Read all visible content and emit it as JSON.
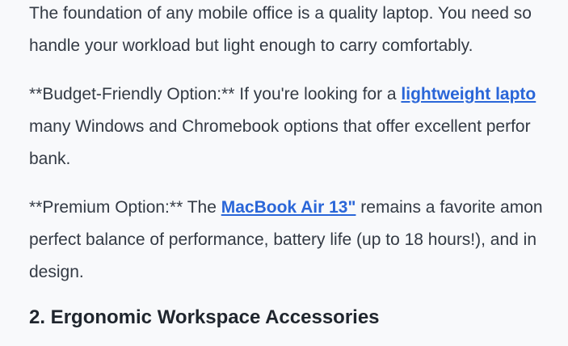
{
  "article": {
    "paragraphs": [
      {
        "line1": "The foundation of any mobile office is a quality laptop. You need so",
        "line2": "handle your workload but light enough to carry comfortably."
      },
      {
        "prefix": "**Budget-Friendly Option:** If you're looking for a ",
        "link": "lightweight lapto",
        "line2": "many Windows and Chromebook options that offer excellent perfor",
        "line3": "bank."
      },
      {
        "prefix": "**Premium Option:** The ",
        "link": "MacBook Air 13\"",
        "suffix": " remains a favorite amon",
        "line2": "perfect balance of performance, battery life (up to 18 hours!), and in",
        "line3": "design."
      }
    ],
    "heading": "2. Ergonomic Workspace Accessories"
  },
  "colors": {
    "background": "#f8f9fb",
    "text": "#333a44",
    "link": "#2a66d8",
    "heading": "#1f252d"
  }
}
